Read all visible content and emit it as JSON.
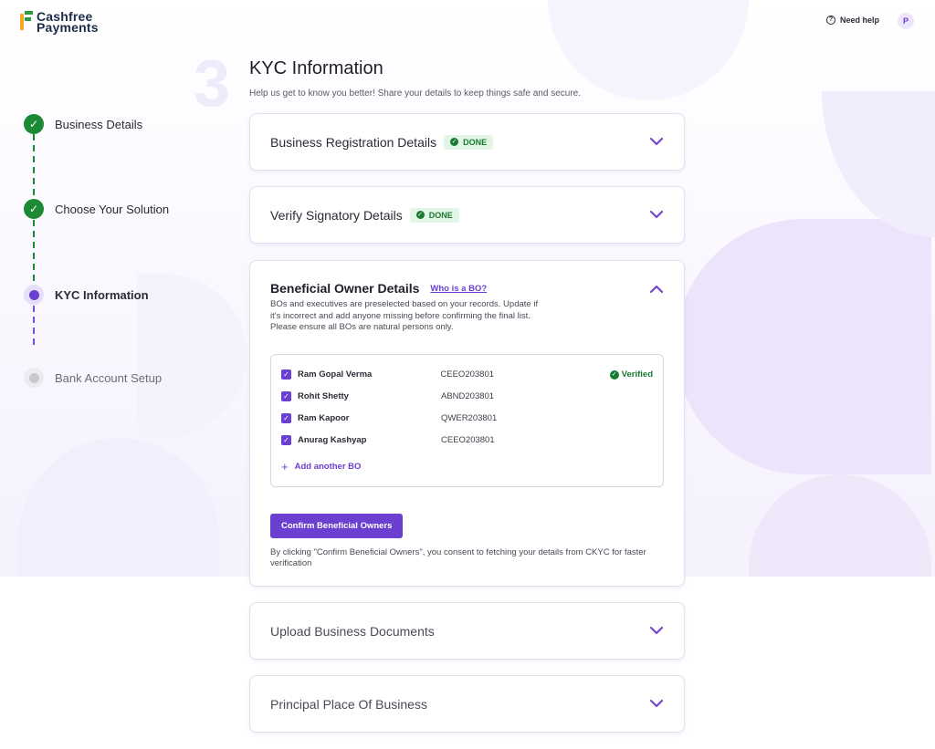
{
  "header": {
    "logo_line1": "Cashfree",
    "logo_line2": "Payments",
    "help_label": "Need help",
    "avatar_initial": "P"
  },
  "stepper": {
    "steps": [
      {
        "label": "Business Details",
        "status": "done"
      },
      {
        "label": "Choose Your Solution",
        "status": "done"
      },
      {
        "label": "KYC Information",
        "status": "active"
      },
      {
        "label": "Bank Account Setup",
        "status": "pending"
      }
    ]
  },
  "page": {
    "step_number": "3",
    "title": "KYC Information",
    "subtitle": "Help us get to know you better! Share your details to keep things safe and secure."
  },
  "sections": {
    "business_registration": {
      "title": "Business Registration Details",
      "badge": "DONE"
    },
    "verify_signatory": {
      "title": "Verify Signatory Details",
      "badge": "DONE"
    },
    "beneficial_owner": {
      "title": "Beneficial Owner Details",
      "link": "Who is a BO?",
      "description": "BOs and executives are preselected based on your records. Update if it's incorrect and add anyone missing before confirming the final list. Please ensure all BOs are natural persons only.",
      "owners": [
        {
          "name": "Ram Gopal Verma",
          "id": "CEEO203801",
          "verified": "Verified"
        },
        {
          "name": "Rohit Shetty",
          "id": "ABND203801",
          "verified": ""
        },
        {
          "name": "Ram Kapoor",
          "id": "QWER203801",
          "verified": ""
        },
        {
          "name": "Anurag Kashyap",
          "id": "CEEO203801",
          "verified": ""
        }
      ],
      "add_label": "Add another BO",
      "confirm_label": "Confirm Beneficial Owners",
      "consent": "By clicking \"Confirm Beneficial Owners\", you consent to fetching your details from CKYC for faster verification"
    },
    "upload_documents": {
      "title": "Upload Business Documents"
    },
    "principal_place": {
      "title": "Principal Place Of Business"
    }
  },
  "colors": {
    "accent": "#6b3fd0",
    "success": "#1c8a34"
  }
}
